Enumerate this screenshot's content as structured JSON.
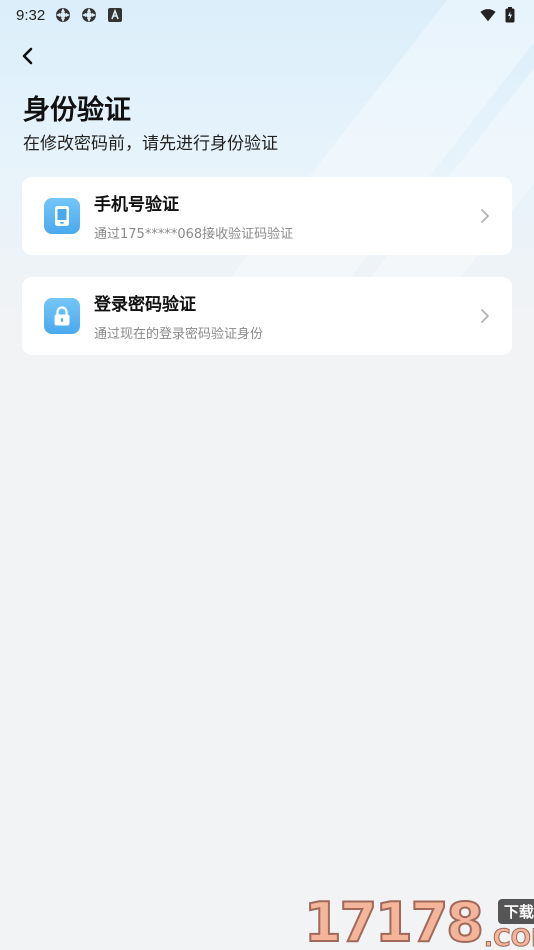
{
  "status_bar": {
    "time": "9:32",
    "icons_left": [
      "settings-gear-icon",
      "settings-gear-icon",
      "a-notification-icon"
    ],
    "icons_right": [
      "wifi-icon",
      "battery-icon"
    ]
  },
  "header": {
    "back_icon": "back-chevron-icon",
    "title": "身份验证",
    "subtitle": "在修改密码前，请先进行身份验证"
  },
  "options": [
    {
      "icon": "phone-icon",
      "title": "手机号验证",
      "description": "通过175*****068接收验证码验证"
    },
    {
      "icon": "lock-icon",
      "title": "登录密码验证",
      "description": "通过现在的登录密码验证身份"
    }
  ],
  "watermark": {
    "digits": "17178",
    "tag": "下载站",
    "suffix": ".COM"
  },
  "colors": {
    "accent": "#4aa9ee",
    "background": "#f2f3f5",
    "card": "#ffffff",
    "muted_text": "#8a8a8a"
  }
}
